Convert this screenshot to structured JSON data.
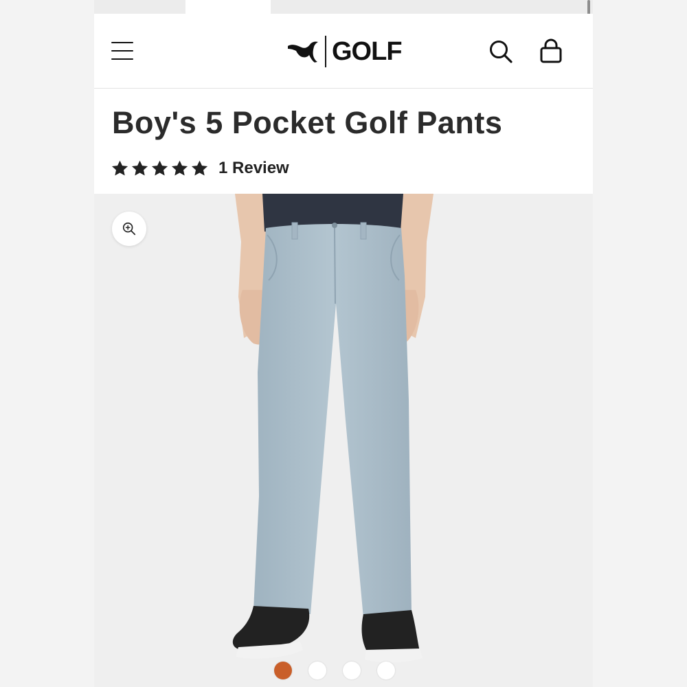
{
  "header": {
    "menu_icon": "hamburger-menu-icon",
    "brand_logo": "puma-cat-logo",
    "brand_word": "GOLF",
    "search_icon": "search-icon",
    "cart_icon": "shopping-bag-icon"
  },
  "product": {
    "title": "Boy's 5 Pocket Golf Pants",
    "rating": 5,
    "rating_max": 5,
    "review_label": "1 Review",
    "image_alt": "boy wearing light blue golf pants",
    "zoom_icon": "zoom-in-icon"
  },
  "carousel": {
    "count": 4,
    "active_index": 0
  },
  "colors": {
    "accent": "#c95f2a",
    "text": "#2b2b2b",
    "pants": "#a9bcc8"
  }
}
